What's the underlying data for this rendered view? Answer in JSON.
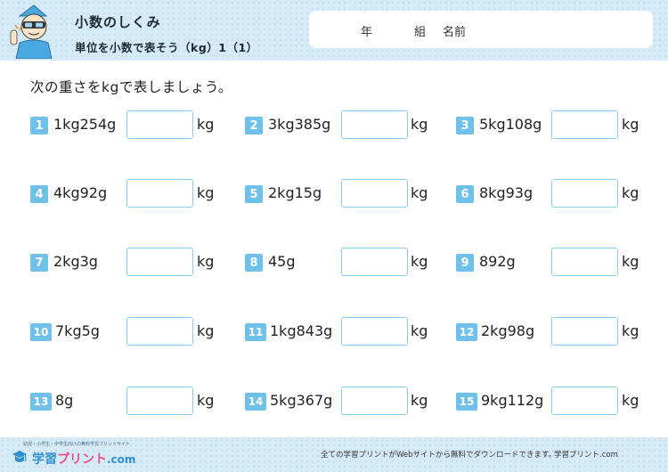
{
  "header": {
    "title": "小数のしくみ",
    "subtitle": "単位を小数で表そう（kg）1（1）",
    "name_fields": {
      "year": "年",
      "class": "組",
      "name": "名前"
    }
  },
  "instruction": "次の重さをkgで表しましょう。",
  "unit": "kg",
  "problems": [
    {
      "number": "1",
      "text": "1kg254g"
    },
    {
      "number": "2",
      "text": "3kg385g"
    },
    {
      "number": "3",
      "text": "5kg108g"
    },
    {
      "number": "4",
      "text": "4kg92g"
    },
    {
      "number": "5",
      "text": "2kg15g"
    },
    {
      "number": "6",
      "text": "8kg93g"
    },
    {
      "number": "7",
      "text": "2kg3g"
    },
    {
      "number": "8",
      "text": "45g"
    },
    {
      "number": "9",
      "text": "892g"
    },
    {
      "number": "10",
      "text": "7kg5g"
    },
    {
      "number": "11",
      "text": "1kg843g"
    },
    {
      "number": "12",
      "text": "2kg98g"
    },
    {
      "number": "13",
      "text": "8g"
    },
    {
      "number": "14",
      "text": "5kg367g"
    },
    {
      "number": "15",
      "text": "9kg112g"
    }
  ],
  "footer": {
    "logo_tagline": "幼児・小学生・中学生向けの無料学習プリントサイト",
    "logo_part1": "学習",
    "logo_part2": "プリント",
    "logo_part3": ".com",
    "note": "全ての学習プリントがWebサイトから無料でダウンロードできます。",
    "site": "学習プリント.com"
  },
  "colors": {
    "header_bg": "#d6ebf7",
    "number_badge": "#6fc1ea",
    "answer_border": "#8ccbea"
  }
}
